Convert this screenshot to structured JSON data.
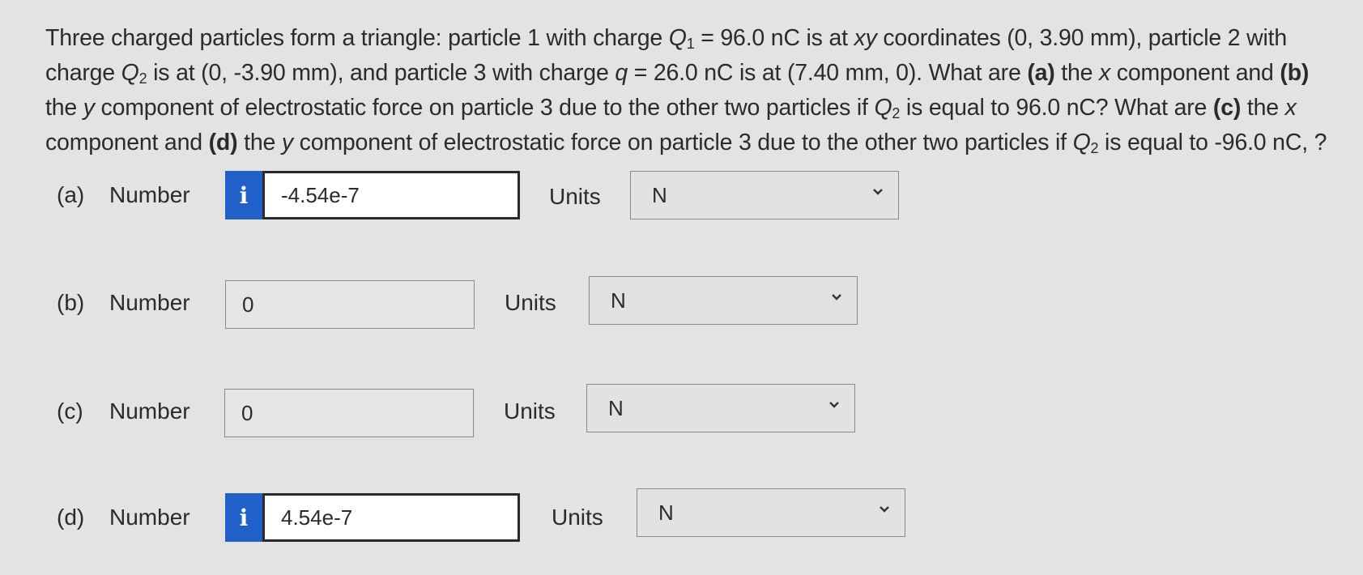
{
  "question": {
    "segments": [
      {
        "t": "Three charged particles form a triangle: particle 1 with charge "
      },
      {
        "t": "Q",
        "i": true
      },
      {
        "sub": "1"
      },
      {
        "t": " = 96.0 nC is at "
      },
      {
        "t": "xy",
        "i": true
      },
      {
        "t": " coordinates (0, 3.90 mm), particle 2 with charge "
      },
      {
        "t": "Q",
        "i": true
      },
      {
        "sub": "2"
      },
      {
        "t": " is at (0, -3.90 mm), and particle 3 with charge "
      },
      {
        "t": "q",
        "i": true
      },
      {
        "t": " = 26.0 nC is at (7.40 mm, 0). What are "
      },
      {
        "t": "(a)",
        "b": true
      },
      {
        "t": " the "
      },
      {
        "t": "x",
        "i": true
      },
      {
        "t": " component and "
      },
      {
        "t": "(b)",
        "b": true
      },
      {
        "t": " the "
      },
      {
        "t": "y",
        "i": true
      },
      {
        "t": " component of electrostatic force on particle 3 due to the other two particles if "
      },
      {
        "t": "Q",
        "i": true
      },
      {
        "sub": "2"
      },
      {
        "t": " is equal to 96.0 nC? What are "
      },
      {
        "t": "(c)",
        "b": true
      },
      {
        "t": " the "
      },
      {
        "t": "x",
        "i": true
      },
      {
        "t": " component and "
      },
      {
        "t": "(d)",
        "b": true
      },
      {
        "t": " the "
      },
      {
        "t": "y",
        "i": true
      },
      {
        "t": " component of electrostatic force on particle 3 due to the other two particles if "
      },
      {
        "t": "Q",
        "i": true
      },
      {
        "sub": "2"
      },
      {
        "t": " is equal to -96.0 nC, ?"
      }
    ]
  },
  "parts": [
    {
      "label": "(a)",
      "number_label": "Number",
      "value": "-4.54e-7",
      "has_info": true,
      "info_glyph": "i",
      "units_label": "Units",
      "unit": "N"
    },
    {
      "label": "(b)",
      "number_label": "Number",
      "value": "0",
      "has_info": false,
      "units_label": "Units",
      "unit": "N"
    },
    {
      "label": "(c)",
      "number_label": "Number",
      "value": "0",
      "has_info": false,
      "units_label": "Units",
      "unit": "N"
    },
    {
      "label": "(d)",
      "number_label": "Number",
      "value": "4.54e-7",
      "has_info": true,
      "info_glyph": "i",
      "units_label": "Units",
      "unit": "N"
    }
  ],
  "colors": {
    "background": "#e3e3e1",
    "info_button": "#1f61c9",
    "text": "#2b2b2b"
  },
  "icons": {
    "info": "info-icon",
    "dropdown": "chevron-down-icon"
  }
}
